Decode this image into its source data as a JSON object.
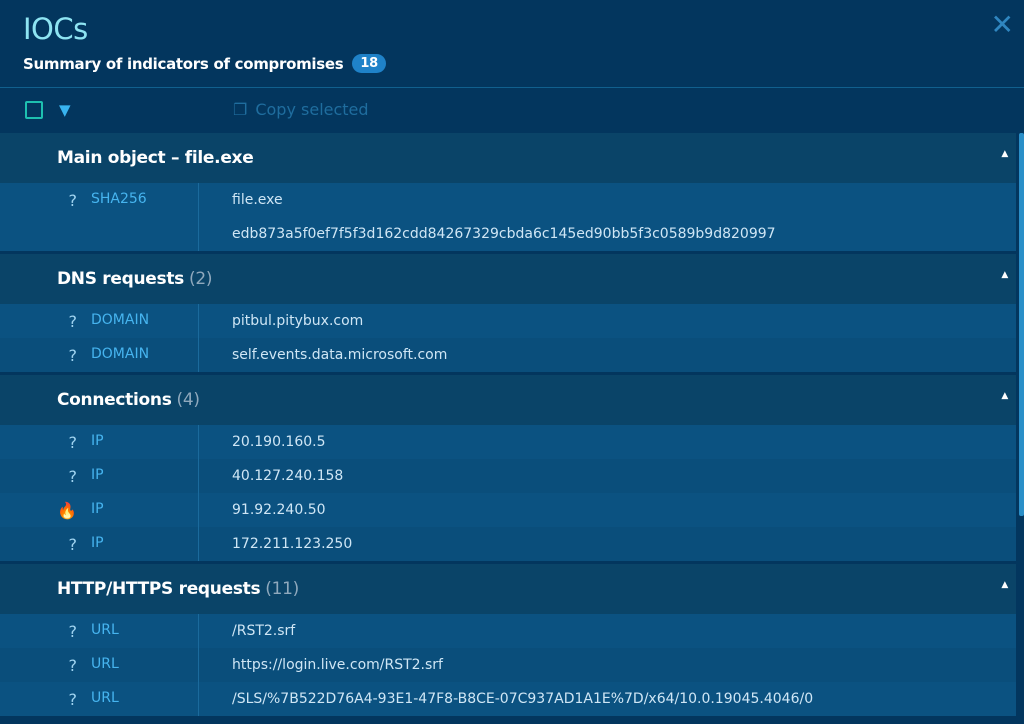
{
  "header": {
    "title": "IOCs",
    "subtitle": "Summary of indicators of compromises",
    "count": "18",
    "close": "✕"
  },
  "toolbar": {
    "copy_label": "Copy selected"
  },
  "sections": [
    {
      "title": "Main object – file.exe",
      "count": "",
      "rows": [
        {
          "icon": "?",
          "type": "SHA256",
          "values": [
            "file.exe",
            "edb873a5f0ef7f5f3d162cdd84267329cbda6c145ed90bb5f3c0589b9d820997"
          ]
        }
      ]
    },
    {
      "title": "DNS requests",
      "count": "(2)",
      "rows": [
        {
          "icon": "?",
          "type": "DOMAIN",
          "values": [
            "pitbul.pitybux.com"
          ]
        },
        {
          "icon": "?",
          "type": "DOMAIN",
          "values": [
            "self.events.data.microsoft.com"
          ]
        }
      ]
    },
    {
      "title": "Connections",
      "count": "(4)",
      "rows": [
        {
          "icon": "?",
          "type": "IP",
          "values": [
            "20.190.160.5"
          ]
        },
        {
          "icon": "?",
          "type": "IP",
          "values": [
            "40.127.240.158"
          ]
        },
        {
          "icon": "🔥",
          "type": "IP",
          "values": [
            "91.92.240.50"
          ],
          "malicious": true
        },
        {
          "icon": "?",
          "type": "IP",
          "values": [
            "172.211.123.250"
          ]
        }
      ]
    },
    {
      "title": "HTTP/HTTPS requests",
      "count": "(11)",
      "rows": [
        {
          "icon": "?",
          "type": "URL",
          "values": [
            "/RST2.srf"
          ]
        },
        {
          "icon": "?",
          "type": "URL",
          "values": [
            "https://login.live.com/RST2.srf"
          ]
        },
        {
          "icon": "?",
          "type": "URL",
          "values": [
            "/SLS/%7B522D76A4-93E1-47F8-B8CE-07C937AD1A1E%7D/x64/10.0.19045.4046/0"
          ]
        }
      ]
    }
  ]
}
